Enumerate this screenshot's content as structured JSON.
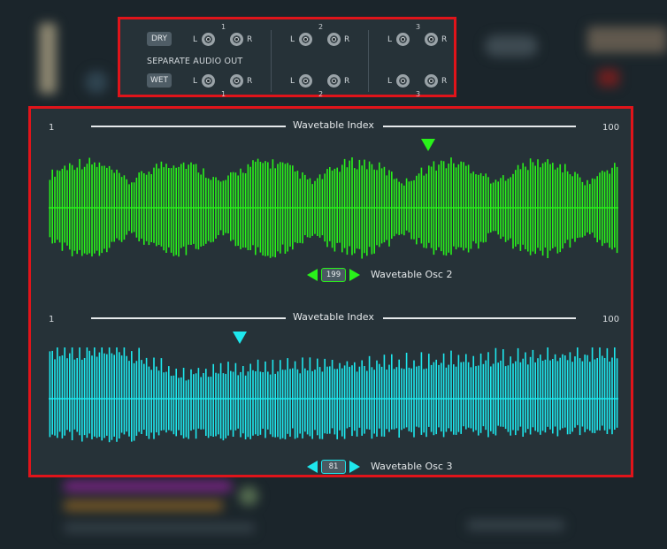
{
  "colors": {
    "frame": "#e0141a",
    "osc2": "#29f21a",
    "osc3": "#1ee8ee",
    "panel": "#263238"
  },
  "audio_out": {
    "dry_label": "DRY",
    "wet_label": "WET",
    "section_label": "SEPARATE AUDIO OUT",
    "left": "L",
    "right": "R",
    "channels": [
      "1",
      "2",
      "3"
    ]
  },
  "osc2": {
    "index_min": "1",
    "index_max": "100",
    "index_title": "Wavetable Index",
    "position_value": "199",
    "label": "Wavetable Osc 2"
  },
  "osc3": {
    "index_min": "1",
    "index_max": "100",
    "index_title": "Wavetable Index",
    "position_value": "81",
    "label": "Wavetable Osc 3"
  }
}
